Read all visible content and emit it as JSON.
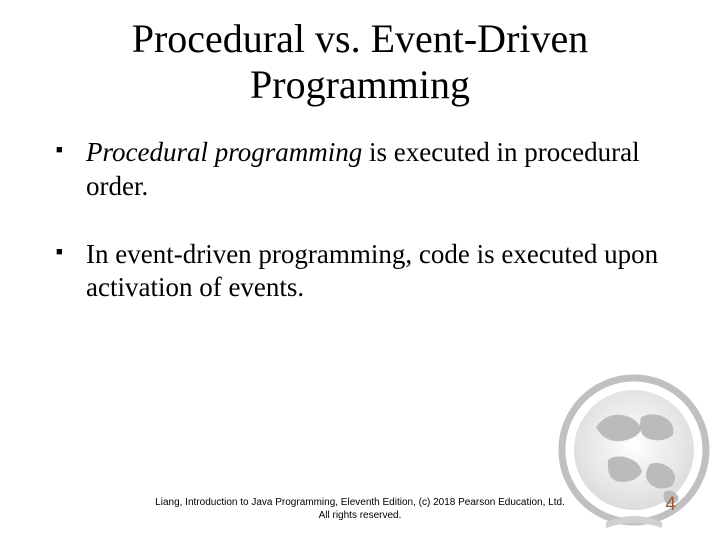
{
  "title": "Procedural vs. Event-Driven Programming",
  "bullets": [
    {
      "emph": "Procedural programming",
      "rest": " is executed in procedural order."
    },
    {
      "emph": "",
      "rest": "In event-driven programming, code is executed upon activation of events."
    }
  ],
  "footer": {
    "line1": "Liang, Introduction to Java Programming, Eleventh Edition, (c) 2018 Pearson Education, Ltd.",
    "line2": "All rights reserved."
  },
  "page_number": "4"
}
